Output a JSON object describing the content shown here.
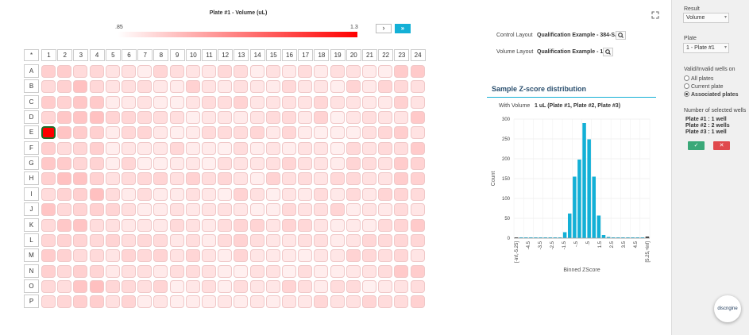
{
  "plate_view": {
    "title": "Plate #1 - Volume (uL)",
    "scale_min": ".85",
    "scale_max": "1.3",
    "next_label": "›",
    "fast_label": "»",
    "corner_label": "*",
    "columns": [
      "1",
      "2",
      "3",
      "4",
      "5",
      "6",
      "7",
      "8",
      "9",
      "10",
      "11",
      "12",
      "13",
      "14",
      "15",
      "16",
      "17",
      "18",
      "19",
      "20",
      "21",
      "22",
      "23",
      "24"
    ],
    "rows": [
      "A",
      "B",
      "C",
      "D",
      "E",
      "F",
      "G",
      "H",
      "I",
      "J",
      "K",
      "L",
      "M",
      "N",
      "O",
      "P"
    ],
    "selected_well": "E1",
    "selected_color": "#ff0000",
    "scale_colors": [
      "#ffffff",
      "#ff0000"
    ]
  },
  "layouts": {
    "control_label": "Control Layout",
    "control_value": "Qualification Example - 384-SAM",
    "volume_label": "Volume Layout",
    "volume_value": "Qualification Example - 1 uL"
  },
  "zscore": {
    "title": "Sample Z-score distribution",
    "with_volume_label": "With Volume",
    "with_volume_value": "1 uL (Plate #1, Plate #2, Plate #3)"
  },
  "chart_data": {
    "type": "bar",
    "title": "",
    "xlabel": "Binned ZScore",
    "ylabel": "Count",
    "ylim": [
      0,
      300
    ],
    "yticks": [
      0,
      50,
      100,
      150,
      200,
      250,
      300
    ],
    "xtick_labels": [
      "[-inf,-5.25]",
      "-4.5",
      "-3.5",
      "-2.5",
      "-1.5",
      "-.5",
      ".5",
      "1.5",
      "2.5",
      "3.5",
      "4.5",
      "[5.25,+inf]"
    ],
    "bar_color": "#13b0d6",
    "end_bar_color": "#333333",
    "values": [
      2,
      1,
      1,
      1,
      1,
      1,
      1,
      1,
      1,
      2,
      15,
      62,
      155,
      198,
      290,
      249,
      155,
      57,
      8,
      3,
      2,
      1,
      2,
      1,
      2,
      1,
      1,
      4
    ],
    "grid": true
  },
  "sidebar": {
    "result_label": "Result",
    "result_value": "Volume",
    "plate_label": "Plate",
    "plate_value": "1 - Plate #1",
    "valid_label": "Valid/Invalid wells on",
    "options": [
      "All plates",
      "Current plate",
      "Associated plates"
    ],
    "selected_option": "Associated plates",
    "selected_count_label": "Number of selected wells",
    "counts": [
      "Plate #1 : 1 well",
      "Plate #2 : 2 wells",
      "Plate #3 : 1 well"
    ],
    "ok_icon": "✓",
    "cancel_icon": "✕"
  },
  "brand": {
    "name": "discngine"
  },
  "icons": {
    "expand": "expand-icon",
    "search": "search-icon"
  }
}
